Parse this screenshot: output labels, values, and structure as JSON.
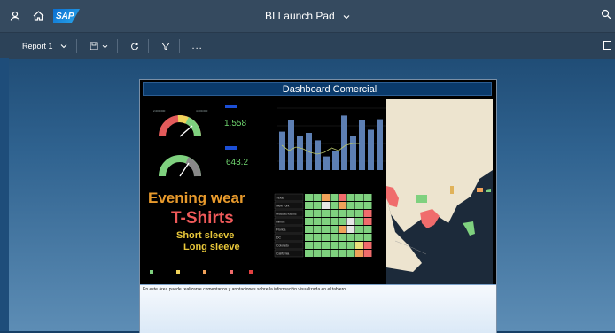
{
  "shell": {
    "title": "BI Launch Pad",
    "icons": [
      "user-icon",
      "home-icon",
      "sap-logo",
      "chevron-down-icon",
      "search-icon"
    ]
  },
  "toolbar": {
    "report_label": "Report 1",
    "more_label": "...",
    "icons": [
      "chevron-down-icon",
      "save-icon",
      "refresh-icon",
      "filter-icon",
      "more-icon",
      "panel-icon"
    ]
  },
  "dashboard": {
    "title": "Dashboard Comercial",
    "kpi_top": "1.558",
    "kpi_bottom": "643.2",
    "wordcloud": [
      {
        "text": "Evening wear",
        "color": "#e89a2c"
      },
      {
        "text": "T-Shirts",
        "color": "#f05a5a"
      },
      {
        "text": "Short sleeve",
        "color": "#e8c73a"
      },
      {
        "text": "Long sleeve",
        "color": "#e8c73a"
      }
    ],
    "heatmap_rows": [
      "Texas",
      "New York",
      "Massachusetts",
      "Illinois",
      "Florida",
      "DC",
      "Colorado",
      "California"
    ],
    "notes_text": "En este área puede realizarse comentarios y anotaciones sobre la información visualizada en el tablero"
  },
  "colors": {
    "shell_bg": "#354a5f",
    "toolbar_bg": "#2c4258",
    "dash_title_bg": "#0a3a6b",
    "bar_color": "#5d7fb3",
    "heat_green": "#7fd17f",
    "heat_red": "#f06c6c",
    "heat_orange": "#f0a25a",
    "kpi_green": "#6fd46f"
  }
}
